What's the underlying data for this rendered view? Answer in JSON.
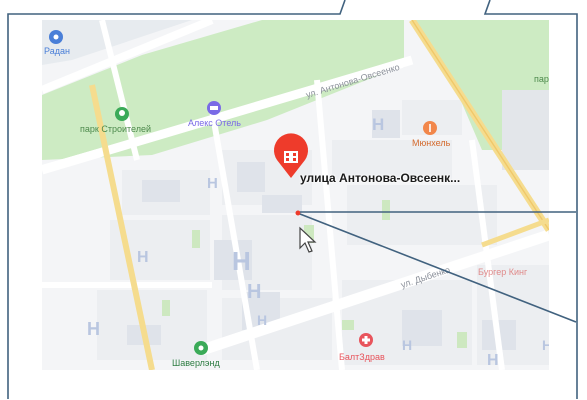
{
  "map": {
    "selected_place": "улица Антонова-Овсеенк...",
    "pois": {
      "radan": "Радан",
      "park": "парк Строителей",
      "hotel": "Алекс Отель",
      "munkhel": "Мюнхель",
      "burger": "Бургер Кинг",
      "shaverlend": "Шаверлэнд",
      "baltzdrav": "БалтЗдрав",
      "park_right": "пар"
    },
    "streets": {
      "antonova": "ул. Антонова-Овсеенко",
      "dybenko": "ул. Дыбенко"
    },
    "map_symbols": {
      "building_marker": "H"
    }
  },
  "colors": {
    "frame": "#41627f",
    "pin": "#ee3b2b",
    "park": "#cdebc3",
    "road_major": "#f5dc8e",
    "block": "#eceef1",
    "poi_hotel": "#7a6ae6",
    "poi_cafe": "#f2874b",
    "poi_green": "#3aaa58",
    "poi_health": "#e8545c",
    "poi_shop": "#4a7fd8"
  },
  "icons": [
    "building-icon",
    "cursor-arrow-icon",
    "park-tree-icon",
    "hotel-bed-icon",
    "food-icon",
    "burger-icon",
    "health-cross-icon",
    "shop-icon"
  ]
}
